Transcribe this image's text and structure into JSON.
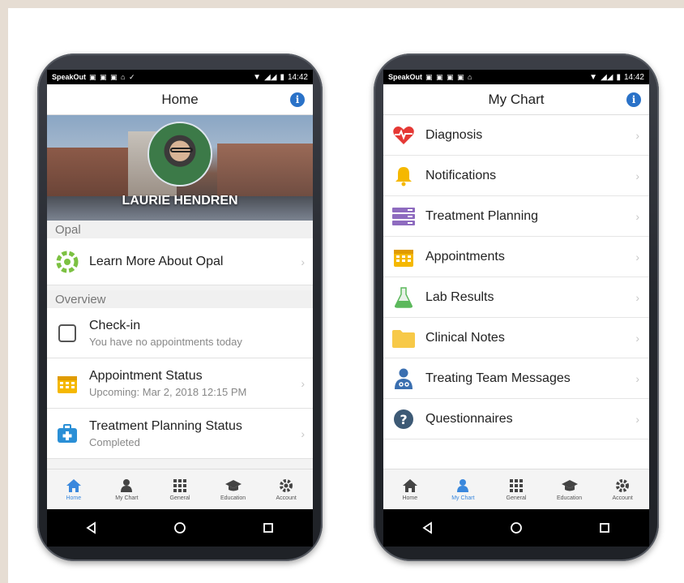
{
  "left_phone": {
    "status_app": "SpeakOut",
    "status_time": "14:42",
    "title": "Home",
    "hero_name": "LAURIE HENDREN",
    "section_opal": "Opal",
    "learn_more": "Learn More About Opal",
    "section_overview": "Overview",
    "checkin_title": "Check-in",
    "checkin_sub": "You have no appointments today",
    "appt_title": "Appointment Status",
    "appt_sub": "Upcoming: Mar 2, 2018 12:15 PM",
    "treat_title": "Treatment Planning Status",
    "treat_sub": "Completed",
    "active_tab": "Home"
  },
  "right_phone": {
    "status_app": "SpeakOut",
    "status_time": "14:42",
    "title": "My Chart",
    "items": [
      {
        "label": "Diagnosis",
        "icon": "heartbeat-icon",
        "color": "#e53935"
      },
      {
        "label": "Notifications",
        "icon": "bell-icon",
        "color": "#f5b800"
      },
      {
        "label": "Treatment Planning",
        "icon": "server-icon",
        "color": "#8e6bbf"
      },
      {
        "label": "Appointments",
        "icon": "calendar-icon",
        "color": "#f5b800"
      },
      {
        "label": "Lab Results",
        "icon": "flask-icon",
        "color": "#5cb85c"
      },
      {
        "label": "Clinical Notes",
        "icon": "folder-icon",
        "color": "#f7c948"
      },
      {
        "label": "Treating Team Messages",
        "icon": "doctor-icon",
        "color": "#3a6fb0"
      },
      {
        "label": "Questionnaires",
        "icon": "question-icon",
        "color": "#3d5a75"
      }
    ],
    "active_tab": "My Chart"
  },
  "tabs": [
    "Home",
    "My Chart",
    "General",
    "Education",
    "Account"
  ],
  "colors": {
    "accent": "#3a88dd",
    "info": "#2a72c8",
    "background": "#e6ddd3"
  }
}
